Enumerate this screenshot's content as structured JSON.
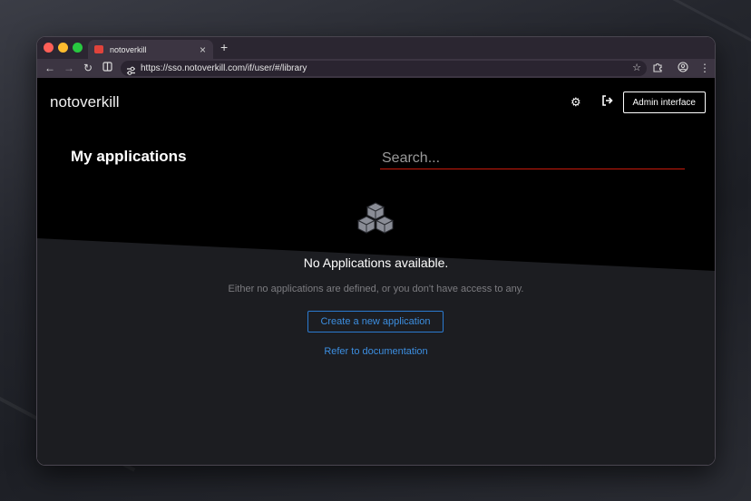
{
  "browser": {
    "tab_title": "notoverkill",
    "tab_close": "×",
    "new_tab": "+",
    "url": "https://sso.notoverkill.com/if/user/#/library",
    "icons": [
      "back-icon",
      "forward-icon",
      "reload-icon",
      "split-view-icon",
      "site-settings-icon",
      "bookmark-star-icon",
      "extensions-icon",
      "profile-icon",
      "menu-icon"
    ]
  },
  "header": {
    "brand": "notoverkill",
    "admin_label": "Admin interface"
  },
  "main": {
    "title": "My applications",
    "search_placeholder": "Search...",
    "empty_title": "No Applications available.",
    "empty_body": "Either no applications are defined, or you don't have access to any.",
    "create_label": "Create a new application",
    "docs_label": "Refer to documentation"
  },
  "colors": {
    "accent_blue": "#3c8ee0",
    "search_underline": "#c9190b",
    "page_bg": "#000000",
    "panel_bg": "#1c1d21"
  }
}
